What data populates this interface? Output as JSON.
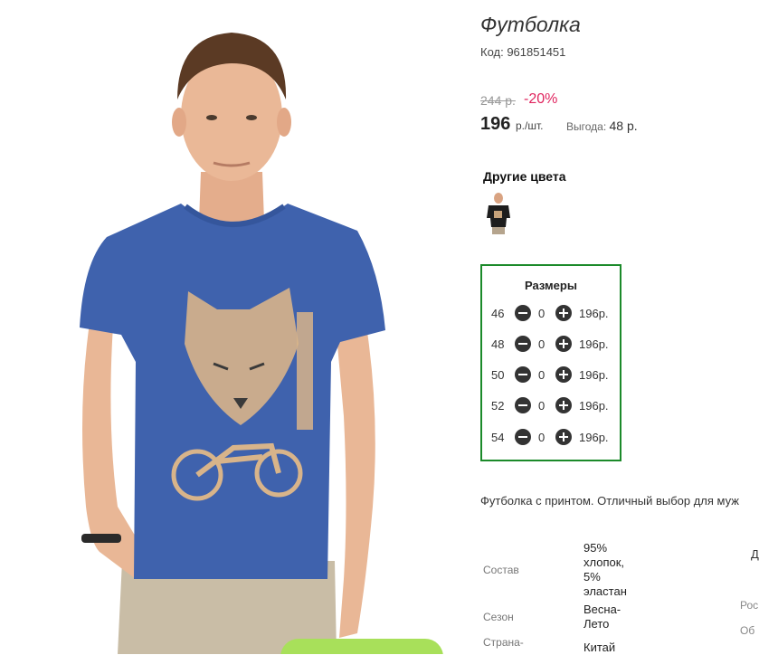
{
  "product": {
    "title": "Футболка",
    "code": "Код: 961851451",
    "old_price": "244 р.",
    "discount": "-20%",
    "price": "196",
    "price_unit": "р./шт.",
    "profit_label": "Выгода:",
    "profit_value": "48 р."
  },
  "other_colors": {
    "heading": "Другие цвета"
  },
  "sizes": {
    "heading": "Размеры",
    "rows": [
      {
        "size": "46",
        "qty": "0",
        "price": "196р."
      },
      {
        "size": "48",
        "qty": "0",
        "price": "196р."
      },
      {
        "size": "50",
        "qty": "0",
        "price": "196р."
      },
      {
        "size": "52",
        "qty": "0",
        "price": "196р."
      },
      {
        "size": "54",
        "qty": "0",
        "price": "196р."
      }
    ]
  },
  "description": "Футболка с принтом. Отличный выбор для муж",
  "specs": [
    {
      "label": "Состав",
      "value": "95% хлопок, 5% эластан"
    },
    {
      "label": "Сезон",
      "value": "Весна-Лето"
    },
    {
      "label": "Страна-",
      "value": "Китай"
    }
  ],
  "side_texts": {
    "head": "Д",
    "row1": "Рос",
    "row2": "Об"
  },
  "cart_button": {
    "label": ""
  },
  "colors": {
    "shirt": "#3f62ad",
    "discount": "#e0245e",
    "sizes_border": "#1b8a2a",
    "cart_button": "#a8e05a"
  }
}
